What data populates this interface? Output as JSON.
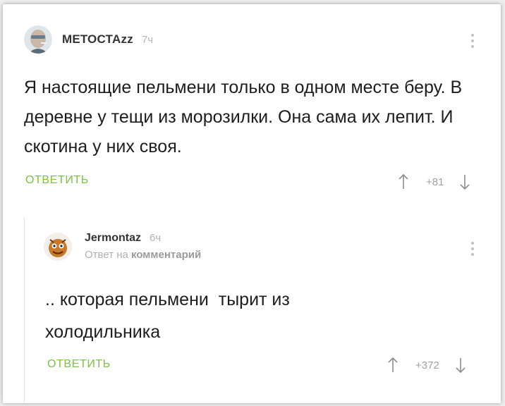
{
  "comment": {
    "author": "МЕТОСТАzz",
    "time": "7ч",
    "text": "Я настоящие пельмени только в одном месте беру. В деревне у тещи из морозилки. Она сама их лепит. И скотина у них своя.",
    "reply_label": "ОТВЕТИТЬ",
    "score": "+81"
  },
  "reply": {
    "author": "Jermontaz",
    "time": "6ч",
    "reply_to_prefix": "Ответ на",
    "reply_to_link": "комментарий",
    "text": ".. которая пельмени  тырит из\nхолодильника",
    "reply_label": "ОТВЕТИТЬ",
    "score": "+372"
  },
  "colors": {
    "accent_green": "#7cc243",
    "muted": "#b4b4b4"
  },
  "icons": [
    "avatar",
    "more-vertical-icon",
    "arrow-up-icon",
    "arrow-down-icon"
  ]
}
